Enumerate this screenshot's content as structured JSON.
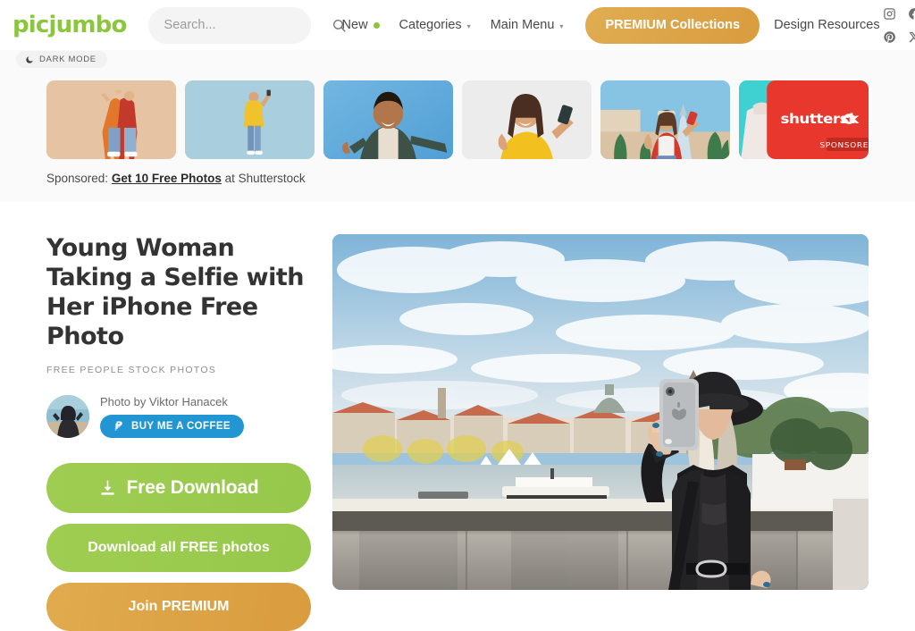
{
  "header": {
    "logo": "picjumbo",
    "search": {
      "placeholder": "Search...",
      "value": "",
      "icon": "search-icon"
    },
    "nav": [
      {
        "label": "New",
        "dot": true,
        "caret": false
      },
      {
        "label": "Categories",
        "dot": false,
        "caret": true
      },
      {
        "label": "Main Menu",
        "dot": false,
        "caret": true
      }
    ],
    "caret_glyph": "▾",
    "premium_button": "PREMIUM Collections",
    "design_resources": "Design Resources",
    "socials": [
      {
        "name": "instagram-icon"
      },
      {
        "name": "facebook-icon"
      },
      {
        "name": "pinterest-icon"
      },
      {
        "name": "x-twitter-icon"
      }
    ],
    "accent_green": "#8cc63f",
    "accent_gold": "#d99c3e"
  },
  "dark_mode": {
    "label": "DARK MODE",
    "icon": "moon-icon"
  },
  "sponsored": {
    "thumbnails": [
      {
        "alt": "couple taking selfie on beige background"
      },
      {
        "alt": "man in yellow shirt taking selfie on blue background"
      },
      {
        "alt": "bearded man with peace sign on blue background"
      },
      {
        "alt": "woman in yellow shirt with peace sign taking selfie"
      },
      {
        "alt": "woman in red jacket taking selfie in Dubai"
      },
      {
        "alt": "bride arm with lace sleeve on teal background"
      }
    ],
    "card": {
      "brand": "shutterstock",
      "badge": "SPONSORED",
      "color": "#e53228"
    },
    "caption_prefix": "Sponsored: ",
    "caption_link": "Get 10 Free Photos",
    "caption_suffix": " at Shutterstock"
  },
  "photo_page": {
    "title": "Young Woman Taking a Selfie with Her iPhone Free Photo",
    "category": "FREE PEOPLE STOCK PHOTOS",
    "author_prefix": "Photo by ",
    "author_name": "Viktor Hanacek",
    "author_line": "Photo by Viktor Hanacek",
    "coffee_button": "BUY ME A COFFEE",
    "coffee_icon": "paypal-icon",
    "buttons": {
      "free_download": "Free Download",
      "download_icon": "download-icon",
      "download_all": "Download all FREE photos",
      "join_premium": "Join PREMIUM"
    },
    "hero_image_alt": "Young woman in black hat and leather jacket taking a selfie with an iPhone on a bridge over a river with city skyline"
  }
}
